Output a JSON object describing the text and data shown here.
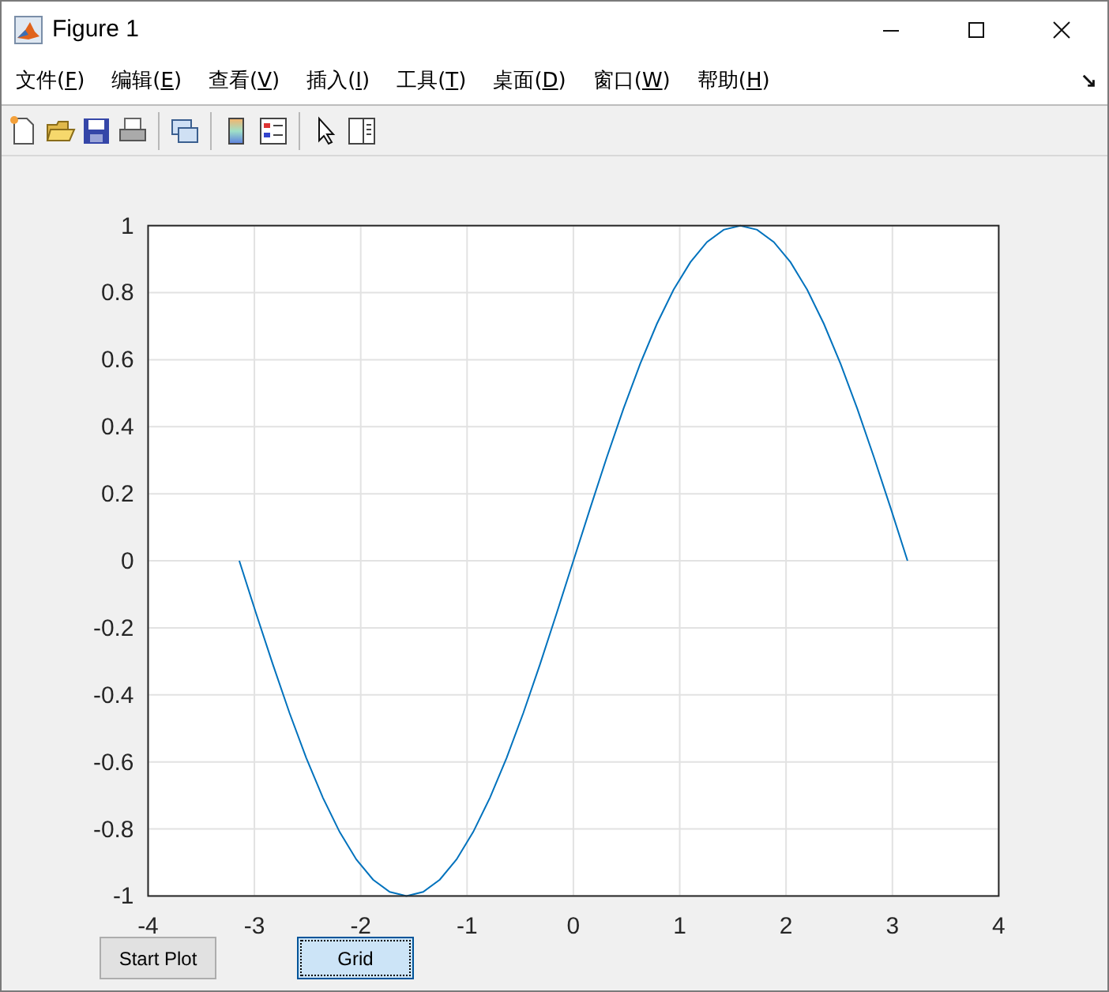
{
  "window": {
    "title": "Figure 1"
  },
  "menu": [
    {
      "label": "文件(",
      "key": "F",
      "after": ")"
    },
    {
      "label": "编辑(",
      "key": "E",
      "after": ")"
    },
    {
      "label": "查看(",
      "key": "V",
      "after": ")"
    },
    {
      "label": "插入(",
      "key": "I",
      "after": ")"
    },
    {
      "label": "工具(",
      "key": "T",
      "after": ")"
    },
    {
      "label": "桌面(",
      "key": "D",
      "after": ")"
    },
    {
      "label": "窗口(",
      "key": "W",
      "after": ")"
    },
    {
      "label": "帮助(",
      "key": "H",
      "after": ")"
    }
  ],
  "chart": {
    "chart_data": {
      "type": "line",
      "xlim": [
        -4,
        4
      ],
      "ylim": [
        -1,
        1
      ],
      "xticks": [
        -4,
        -3,
        -2,
        -1,
        0,
        1,
        2,
        3,
        4
      ],
      "yticks": [
        1,
        0.8,
        0.6,
        0.4,
        0.2,
        0,
        -0.2,
        -0.4,
        -0.6,
        -0.8,
        -1
      ],
      "grid": true,
      "x": [
        -3.142,
        -2.985,
        -2.827,
        -2.67,
        -2.513,
        -2.356,
        -2.199,
        -2.042,
        -1.885,
        -1.728,
        -1.571,
        -1.414,
        -1.257,
        -1.1,
        -0.942,
        -0.785,
        -0.628,
        -0.471,
        -0.314,
        -0.157,
        0,
        0.157,
        0.314,
        0.471,
        0.628,
        0.785,
        0.942,
        1.1,
        1.257,
        1.414,
        1.571,
        1.728,
        1.885,
        2.042,
        2.199,
        2.356,
        2.513,
        2.67,
        2.827,
        2.985,
        3.142
      ],
      "series": [
        {
          "color": "#0072bd",
          "values": [
            0,
            -0.156,
            -0.309,
            -0.454,
            -0.588,
            -0.707,
            -0.809,
            -0.891,
            -0.951,
            -0.988,
            -1,
            -0.988,
            -0.951,
            -0.891,
            -0.809,
            -0.707,
            -0.588,
            -0.454,
            -0.309,
            -0.156,
            0,
            0.156,
            0.309,
            0.454,
            0.588,
            0.707,
            0.809,
            0.891,
            0.951,
            0.988,
            1,
            0.988,
            0.951,
            0.891,
            0.809,
            0.707,
            0.588,
            0.454,
            0.309,
            0.156,
            0
          ]
        }
      ]
    }
  },
  "buttons": [
    {
      "label": "Start Plot",
      "focused": false
    },
    {
      "label": "Grid",
      "focused": true
    }
  ]
}
